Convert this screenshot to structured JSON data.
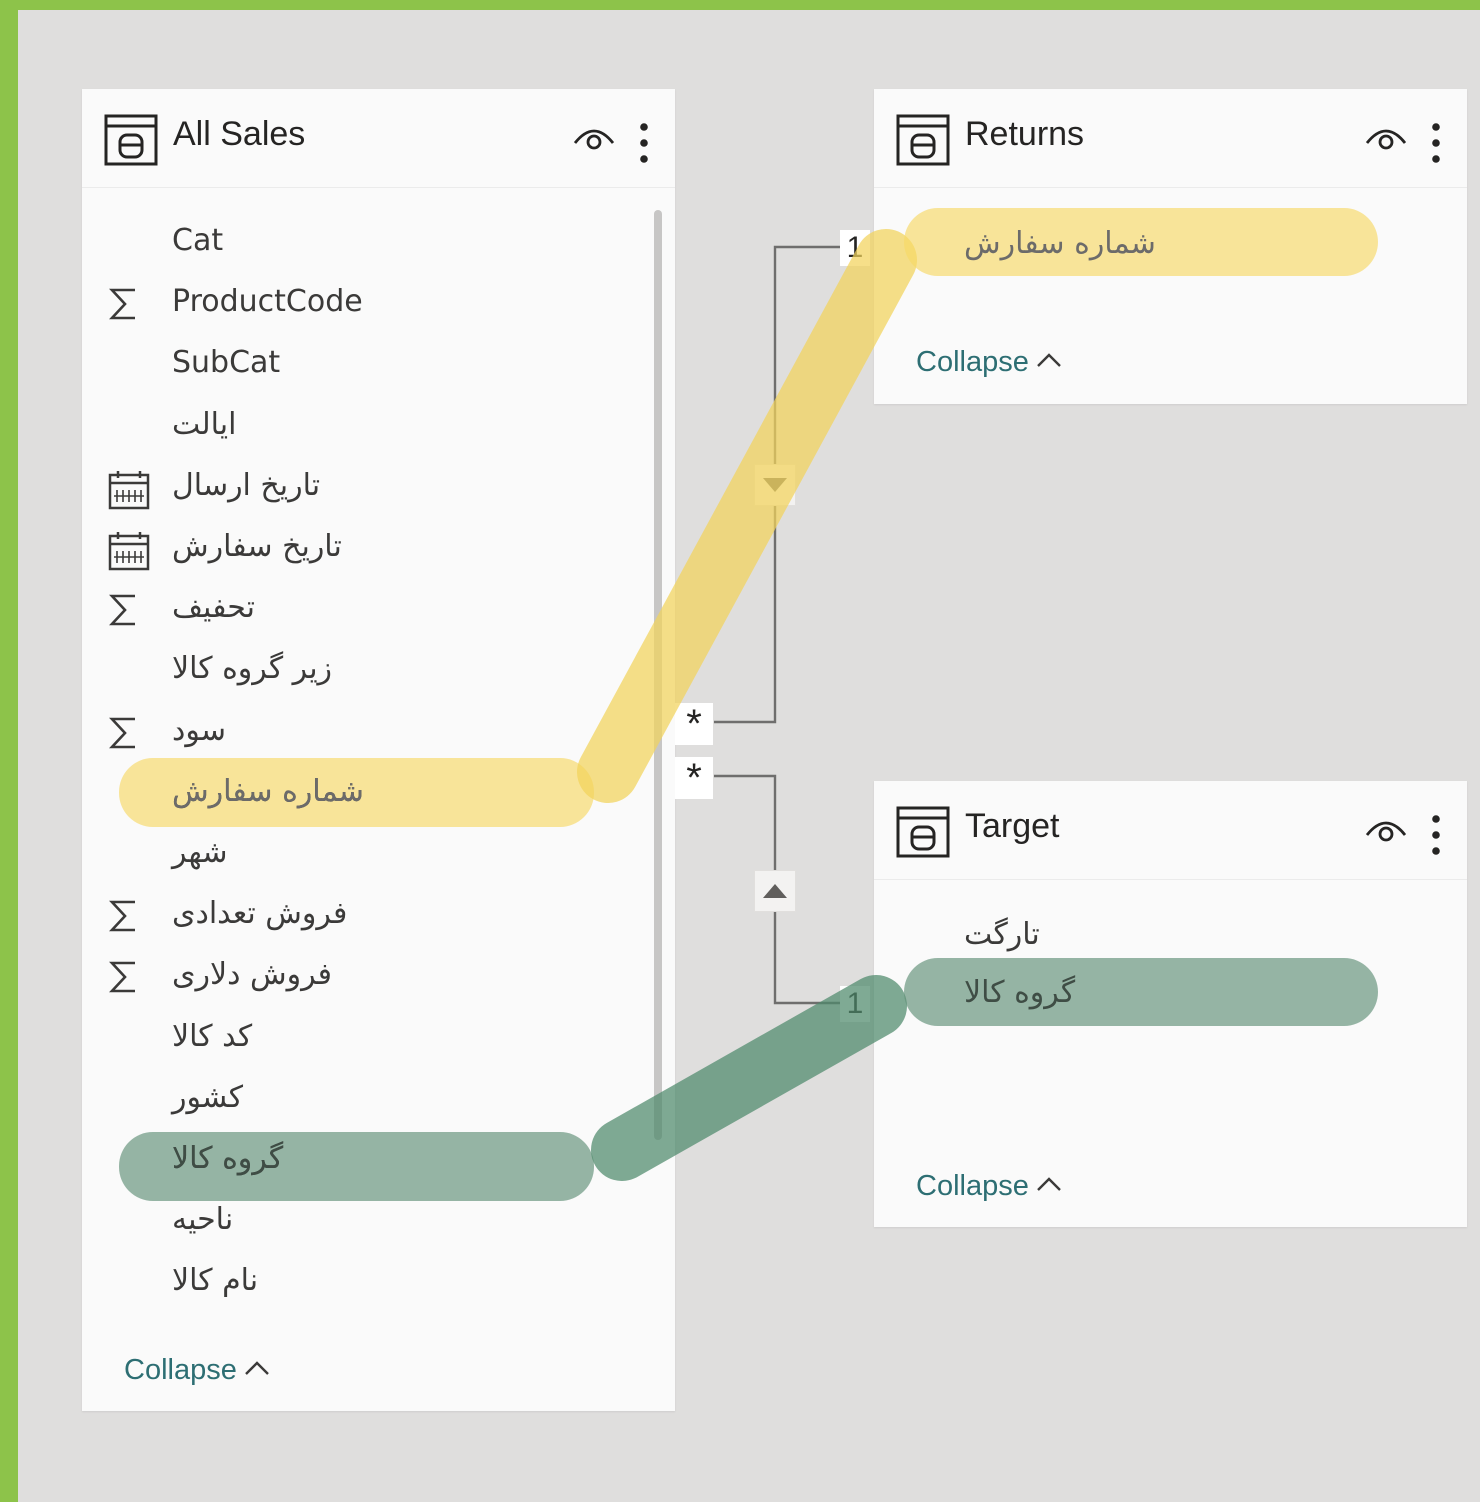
{
  "tables": {
    "all_sales": {
      "title": "All Sales",
      "fields": [
        {
          "label": "Cat",
          "icon": ""
        },
        {
          "label": "ProductCode",
          "icon": "sigma-icon"
        },
        {
          "label": "SubCat",
          "icon": ""
        },
        {
          "label": "ایالت",
          "icon": ""
        },
        {
          "label": "تاریخ ارسال",
          "icon": "calendar-icon"
        },
        {
          "label": "تاریخ سفارش",
          "icon": "calendar-icon"
        },
        {
          "label": "تحفیف",
          "icon": "sigma-icon"
        },
        {
          "label": "زیر گروه کالا",
          "icon": ""
        },
        {
          "label": "سود",
          "icon": "sigma-icon"
        },
        {
          "label": "شماره سفارش",
          "icon": "",
          "highlight": "yellow"
        },
        {
          "label": "شهر",
          "icon": ""
        },
        {
          "label": "فروش تعدادی",
          "icon": "sigma-icon"
        },
        {
          "label": "فروش دلاری",
          "icon": "sigma-icon"
        },
        {
          "label": "کد کالا",
          "icon": ""
        },
        {
          "label": "کشور",
          "icon": ""
        },
        {
          "label": "گروه کالا",
          "icon": "",
          "highlight": "green"
        },
        {
          "label": "ناحیه",
          "icon": ""
        },
        {
          "label": "نام کالا",
          "icon": ""
        }
      ],
      "collapse_label": "Collapse"
    },
    "returns": {
      "title": "Returns",
      "fields": [
        {
          "label": "شماره سفارش",
          "icon": "",
          "highlight": "yellow"
        }
      ],
      "collapse_label": "Collapse"
    },
    "target": {
      "title": "Target",
      "fields": [
        {
          "label": "تارگت",
          "icon": ""
        },
        {
          "label": "گروه کالا",
          "icon": "",
          "highlight": "green"
        }
      ],
      "collapse_label": "Collapse"
    }
  },
  "relationships": [
    {
      "from": "All Sales",
      "to": "Returns",
      "many_label": "*",
      "one_label": "1"
    },
    {
      "from": "All Sales",
      "to": "Target",
      "many_label": "*",
      "one_label": "1"
    }
  ],
  "colors": {
    "canvas": "#dfdedd",
    "frame_border": "#8dc34a",
    "highlight_yellow": "#f7d865",
    "highlight_green": "#5f8f77",
    "link_text": "#2d6e73"
  }
}
